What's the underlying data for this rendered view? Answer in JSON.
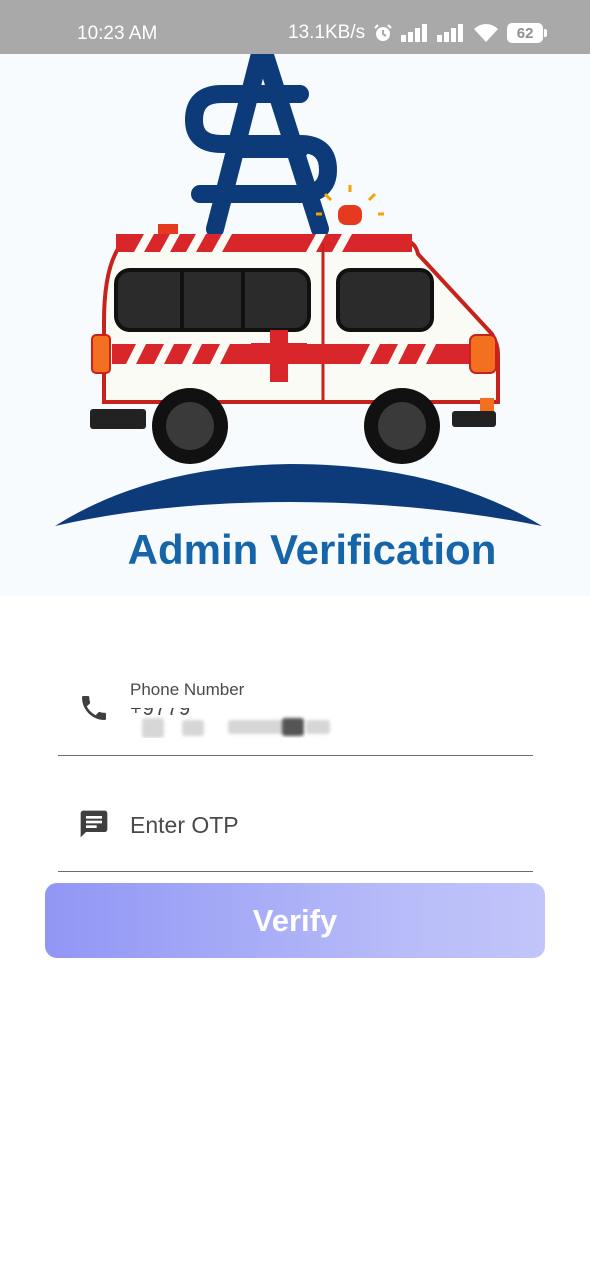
{
  "status_bar": {
    "time": "10:23 AM",
    "network_speed": "13.1KB/s",
    "battery_level": "62",
    "icons": [
      "alarm-icon",
      "signal-icon",
      "signal-icon",
      "wifi-icon",
      "battery-icon"
    ]
  },
  "hero": {
    "logo_letters": "SA",
    "title": "Admin Verification",
    "colors": {
      "brand_blue": "#0d3a78",
      "title_blue": "#1565a8",
      "ambulance_red": "#d9262a"
    }
  },
  "form": {
    "phone": {
      "label": "Phone Number",
      "value": "+9779"
    },
    "otp": {
      "placeholder": "Enter OTP"
    },
    "verify_label": "Verify"
  }
}
